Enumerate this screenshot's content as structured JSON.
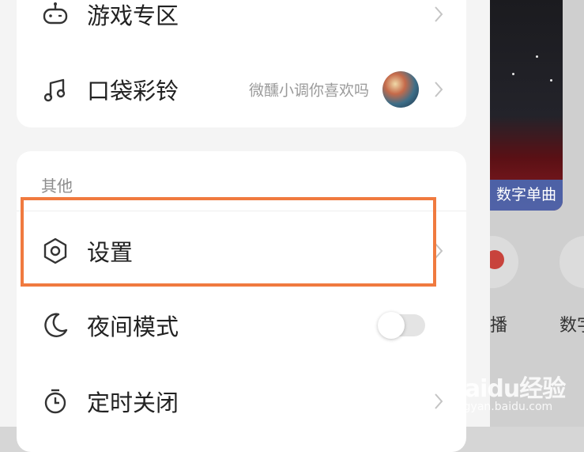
{
  "menu_top": {
    "items": [
      {
        "label": "游戏专区",
        "icon": "gamepad-icon"
      },
      {
        "label": "口袋彩铃",
        "icon": "music-note-icon",
        "hint": "微醺小调你喜欢吗"
      }
    ]
  },
  "menu_other": {
    "section_title": "其他",
    "items": [
      {
        "label": "设置",
        "icon": "hexagon-settings-icon"
      },
      {
        "label": "夜间模式",
        "icon": "moon-icon"
      },
      {
        "label": "定时关闭",
        "icon": "timer-icon"
      }
    ],
    "night_mode_on": false
  },
  "background": {
    "banner_label": "数字单曲",
    "label_a": "播",
    "label_b": "数字"
  },
  "watermark": {
    "main": "Baidu经验",
    "sub": "jingyan.baidu.com"
  },
  "colors": {
    "highlight": "#f07a3f",
    "toggle_off": "#e4e4e4"
  }
}
